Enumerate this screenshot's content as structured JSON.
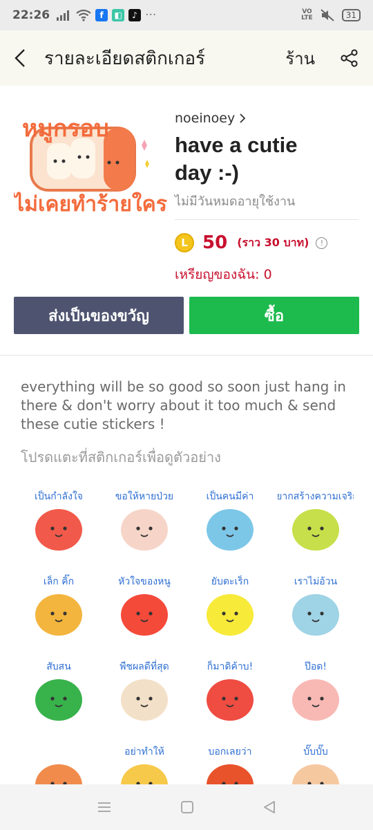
{
  "status_bar": {
    "time": "22:26",
    "dots": "···",
    "volte_top": "VO",
    "volte_bottom": "LTE",
    "battery": "31"
  },
  "header": {
    "title": "รายละเอียดสติกเกอร์",
    "shop_link": "ร้าน"
  },
  "product": {
    "author": "noeinoey",
    "name_line1": "have a cutie",
    "name_line2": "day :-)",
    "expiry": "ไม่มีวันหมดอายุใช้งาน",
    "coin_symbol": "L",
    "price": "50",
    "price_approx": "(ราว 30 บาท)",
    "my_coins": "เหรียญของฉัน: 0",
    "main_sticker_text1": "หมูกรอบ",
    "main_sticker_text2": "ไม่เคยทำร้ายใคร"
  },
  "buttons": {
    "gift": "ส่งเป็นของขวัญ",
    "buy": "ซื้อ"
  },
  "description": "everything will be so good so soon just hang in there & don't worry about it too much & send these cutie stickers !",
  "hint": "โปรดแตะที่สติกเกอร์เพื่อดูตัวอย่าง",
  "stickers": [
    {
      "text": "เป็นกำลังใจ",
      "color": "#f15a4a"
    },
    {
      "text": "ขอให้หายป่วย",
      "color": "#f6d5c8"
    },
    {
      "text": "เป็นคนมีค่า",
      "color": "#7cc7e8"
    },
    {
      "text": "อยากสร้างความเจริญ",
      "color": "#c7df4a"
    },
    {
      "text": "เล็ก คิ๊ก",
      "color": "#f3b53e"
    },
    {
      "text": "หัวใจของหนู",
      "color": "#f44a3a"
    },
    {
      "text": "ยับตะเร็ก",
      "color": "#f7ea39"
    },
    {
      "text": "เราไม่อ้วน",
      "color": "#9fd3e6"
    },
    {
      "text": "สับสน",
      "color": "#38b24b"
    },
    {
      "text": "พืชผลดีที่สุด",
      "color": "#f3e0c8"
    },
    {
      "text": "ก็มาดิค้าบ!",
      "color": "#ef4c42"
    },
    {
      "text": "ป๊อด!",
      "color": "#f8b9b5"
    },
    {
      "text": "",
      "color": "#f08b4c"
    },
    {
      "text": "อย่าทำให้",
      "color": "#f7c94a"
    },
    {
      "text": "บอกเลยว่า",
      "color": "#e8532c"
    },
    {
      "text": "บั๊บบั๊บ",
      "color": "#f6c8a0"
    }
  ]
}
